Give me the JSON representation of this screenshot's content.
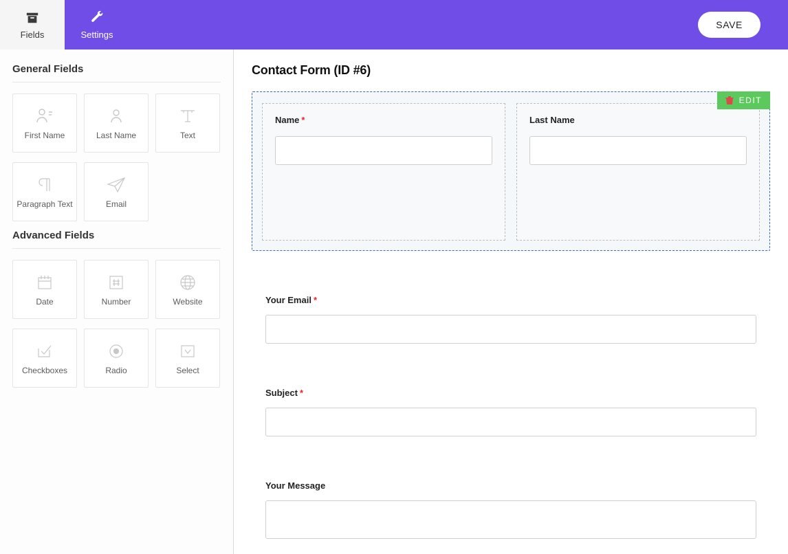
{
  "topbar": {
    "fields_tab": "Fields",
    "settings_tab": "Settings",
    "save_label": "SAVE"
  },
  "sidebar": {
    "general_title": "General Fields",
    "advanced_title": "Advanced Fields",
    "general_items": [
      {
        "label": "First Name"
      },
      {
        "label": "Last Name"
      },
      {
        "label": "Text"
      },
      {
        "label": "Paragraph Text"
      },
      {
        "label": "Email"
      }
    ],
    "advanced_items": [
      {
        "label": "Date"
      },
      {
        "label": "Number"
      },
      {
        "label": "Website"
      },
      {
        "label": "Checkboxes"
      },
      {
        "label": "Radio"
      },
      {
        "label": "Select"
      }
    ]
  },
  "main": {
    "title": "Contact Form (ID #6)",
    "edit_label": "EDIT",
    "fields": {
      "name": {
        "label": "Name",
        "required": true,
        "value": ""
      },
      "last_name": {
        "label": "Last Name",
        "required": false,
        "value": ""
      },
      "email": {
        "label": "Your Email",
        "required": true,
        "value": ""
      },
      "subject": {
        "label": "Subject",
        "required": true,
        "value": ""
      },
      "message": {
        "label": "Your Message",
        "required": false,
        "value": ""
      }
    }
  },
  "colors": {
    "accent": "#704DE6",
    "edit_bg": "#5cc95c",
    "required": "#e23"
  }
}
